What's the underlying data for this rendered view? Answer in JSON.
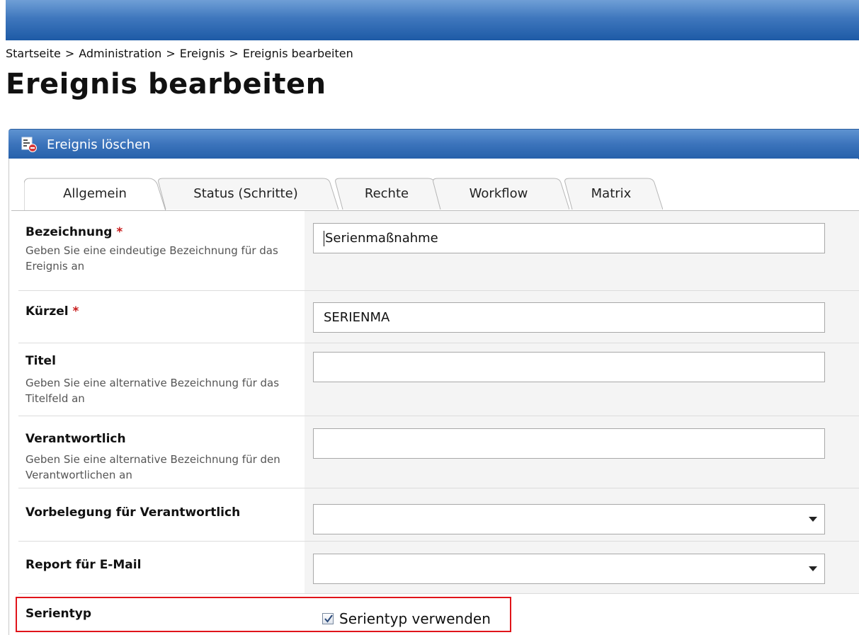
{
  "breadcrumb": [
    "Startseite",
    "Administration",
    "Ereignis",
    "Ereignis bearbeiten"
  ],
  "breadcrumb_separator": ">",
  "page_title": "Ereignis bearbeiten",
  "action": {
    "label": "Ereignis löschen",
    "icon": "delete-document-icon"
  },
  "tabs": [
    {
      "label": "Allgemein",
      "active": true
    },
    {
      "label": "Status (Schritte)",
      "active": false
    },
    {
      "label": "Rechte",
      "active": false
    },
    {
      "label": "Workflow",
      "active": false
    },
    {
      "label": "Matrix",
      "active": false
    }
  ],
  "required_mark": "*",
  "form": {
    "bezeichnung": {
      "label": "Bezeichnung",
      "hint": "Geben Sie eine eindeutige Bezeichnung für das Ereignis an",
      "value": "Serienmaßnahme"
    },
    "kuerzel": {
      "label": "Kürzel",
      "value": "SERIENMA"
    },
    "titel": {
      "label": "Titel",
      "hint": "Geben Sie eine alternative Bezeichnung für das Titelfeld an",
      "value": ""
    },
    "verantwortlich": {
      "label": "Verantwortlich",
      "hint": "Geben Sie eine alternative Bezeichnung für den Verantwortlichen an",
      "value": ""
    },
    "vorbelegung": {
      "label": "Vorbelegung für Verantwortlich",
      "value": ""
    },
    "report": {
      "label": "Report für E-Mail",
      "value": ""
    },
    "serientyp": {
      "label": "Serientyp",
      "checkbox_label": "Serientyp verwenden",
      "checked": true
    }
  },
  "colors": {
    "header_blue": "#1d5aa6",
    "required_red": "#c81a1a",
    "highlight_red": "#e0141a"
  }
}
